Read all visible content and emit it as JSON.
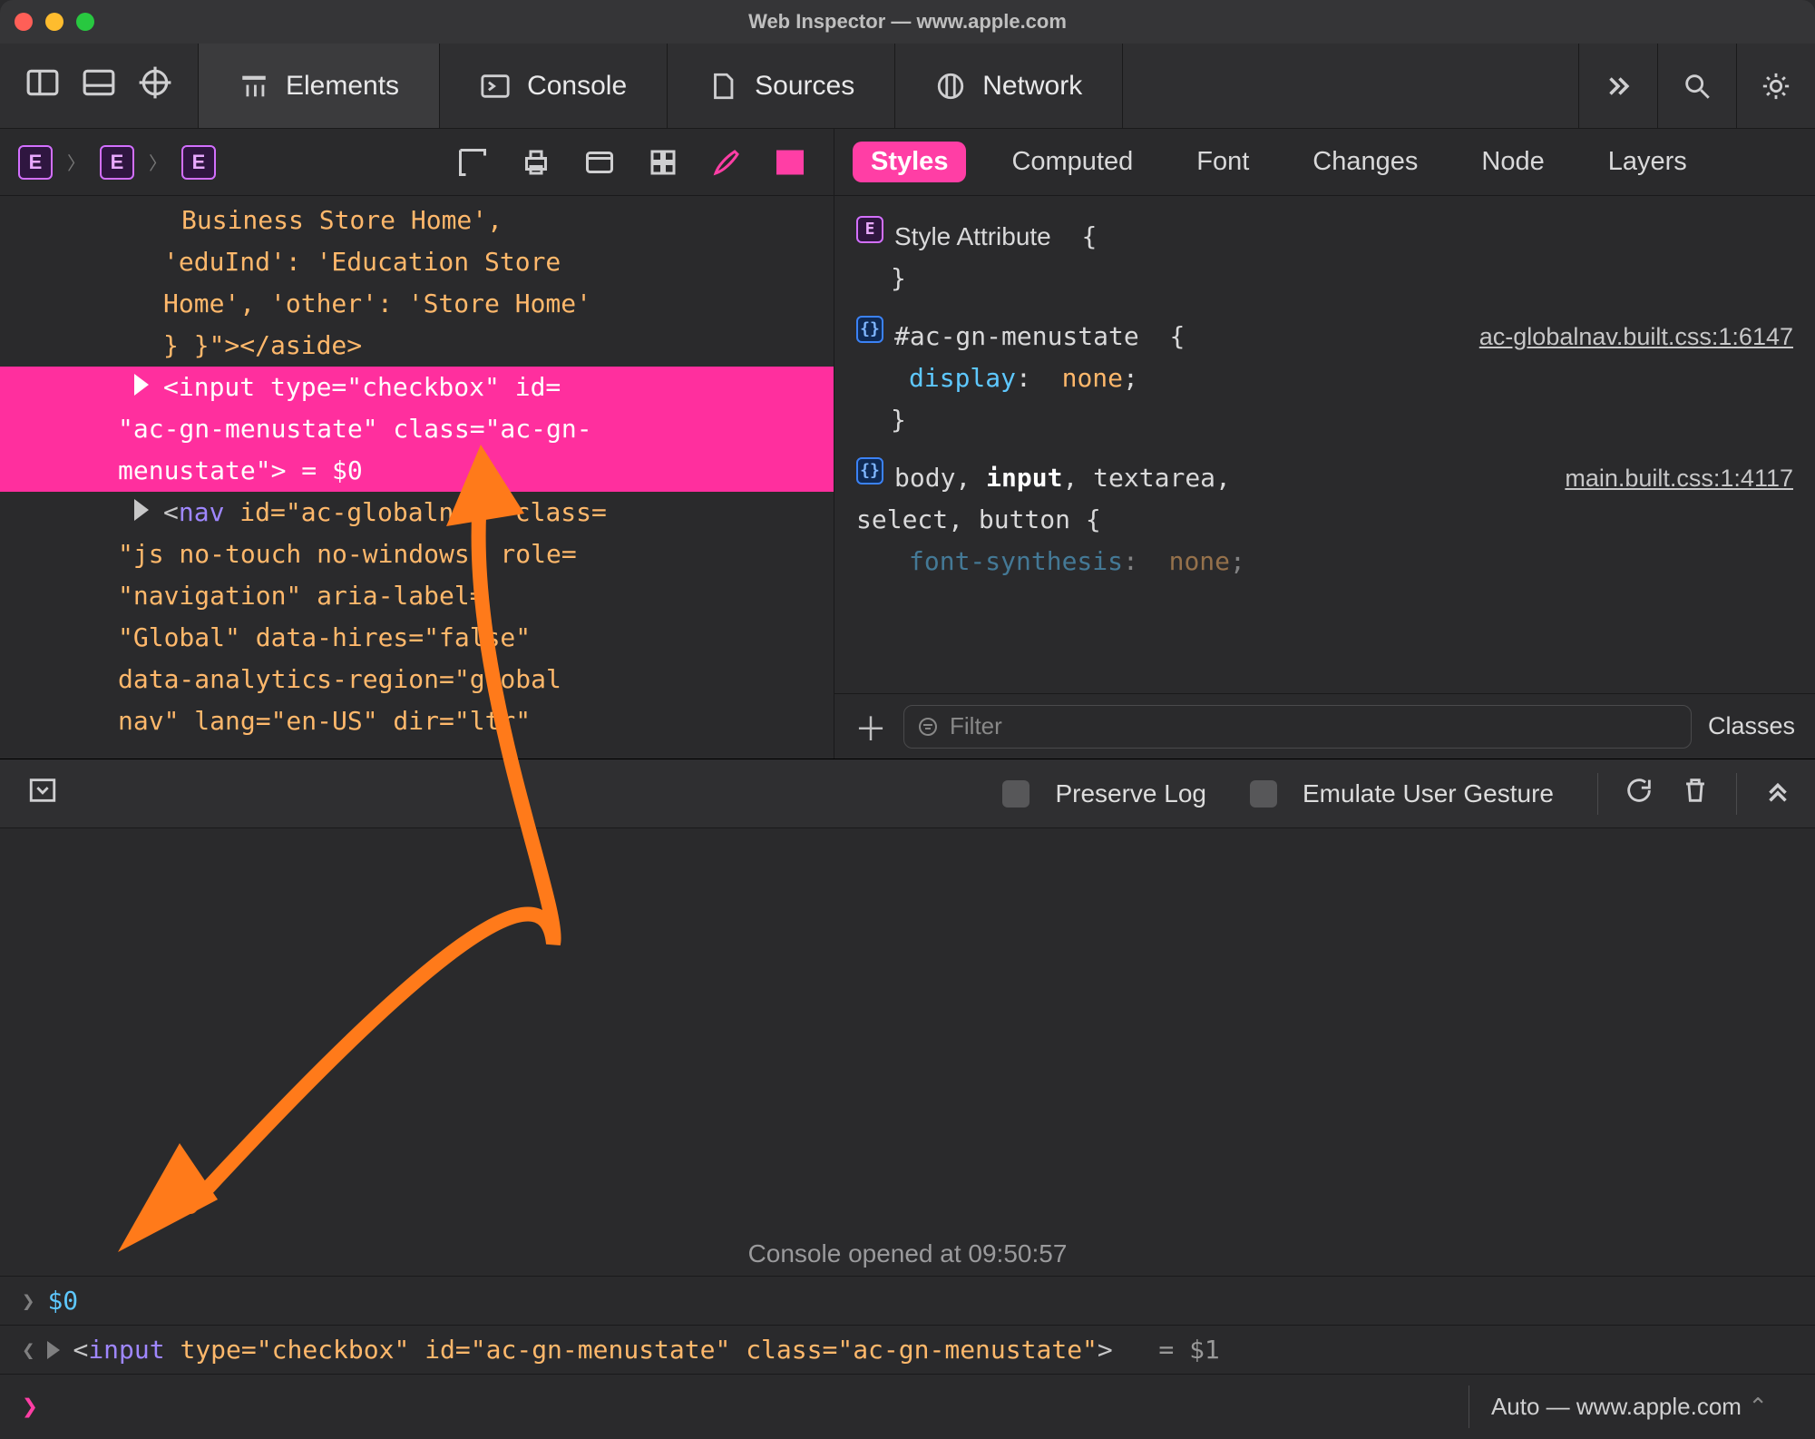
{
  "window": {
    "title": "Web Inspector — www.apple.com"
  },
  "tabs": {
    "elements": "Elements",
    "console": "Console",
    "sources": "Sources",
    "network": "Network"
  },
  "sidepanel": {
    "tabs": {
      "styles": "Styles",
      "computed": "Computed",
      "font": "Font",
      "changes": "Changes",
      "node": "Node",
      "layers": "Layers"
    },
    "style_attribute_label": "Style Attribute",
    "rule1": {
      "selector": "#ac-gn-menustate",
      "src": "ac-globalnav.built.css:1:6147",
      "prop": "display",
      "val": "none"
    },
    "rule2": {
      "selector": "body, input, textarea, select, button",
      "src": "main.built.css:1:4117",
      "prop": "font-synthesis",
      "val": "none"
    },
    "filter_placeholder": "Filter",
    "classes_label": "Classes"
  },
  "dom": {
    "line0": "Business Store Home',",
    "line1": "'eduInd': 'Education Store",
    "line2": "Home', 'other': 'Store Home'",
    "line3": "} }\"></aside>",
    "sel_l1": "<input type=\"checkbox\" id=",
    "sel_l2": "\"ac-gn-menustate\" class=\"ac-gn-",
    "sel_l3": "menustate\">  = $0",
    "nav_l1": "<nav id=\"ac-globalnav\" class=",
    "nav_l2": "\"js no-touch no-windows\" role=",
    "nav_l3": "\"navigation\" aria-label=",
    "nav_l4": "\"Global\" data-hires=\"false\"",
    "nav_l5": "data-analytics-region=\"global",
    "nav_l6": "nav\" lang=\"en-US\" dir=\"ltr\""
  },
  "console": {
    "preserve_log": "Preserve Log",
    "emulate_gesture": "Emulate User Gesture",
    "opened_at": "Console opened at 09:50:57",
    "input_val": "$0",
    "result_tag": "input",
    "result_attrs": "type=\"checkbox\" id=\"ac-gn-menustate\" class=\"ac-gn-menustate\"",
    "result_ref": "= $1",
    "context": "Auto — www.apple.com"
  }
}
